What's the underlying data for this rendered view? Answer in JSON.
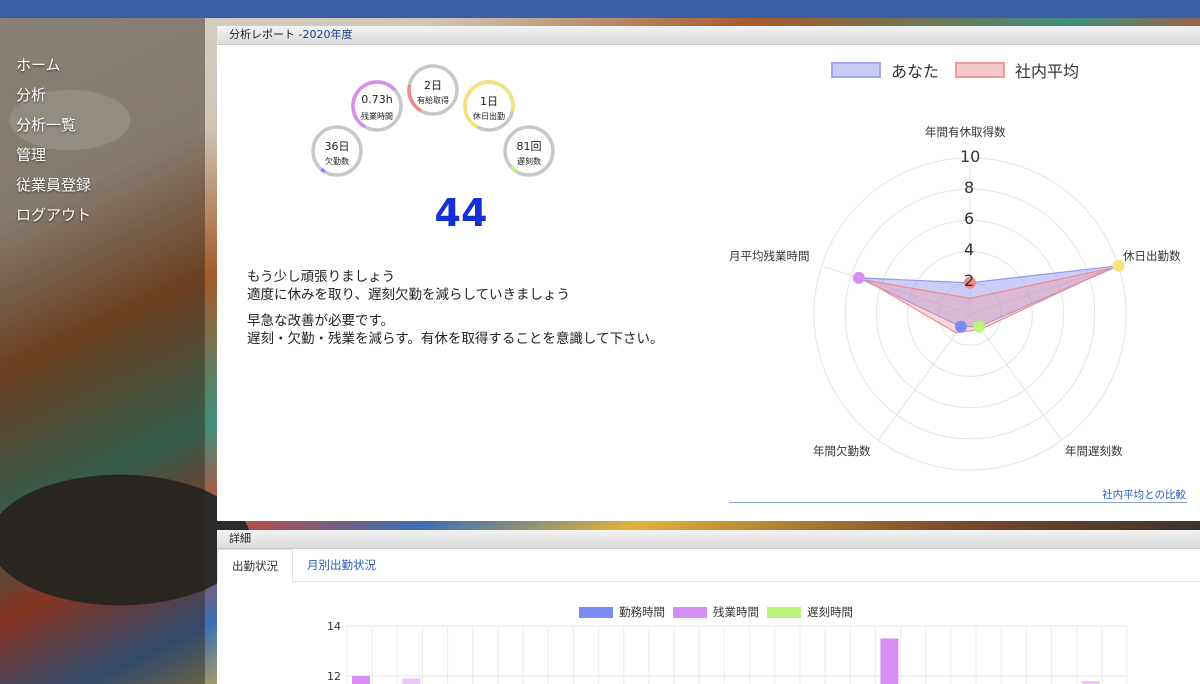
{
  "nav": {
    "items": [
      {
        "label": "ホーム"
      },
      {
        "label": "分析"
      },
      {
        "label": "分析一覧"
      },
      {
        "label": "管理"
      },
      {
        "label": "従業員登録"
      },
      {
        "label": "ログアウト"
      }
    ]
  },
  "report": {
    "title": "分析レポート",
    "year": "-2020年度",
    "gauges": [
      {
        "value": "36日",
        "label": "欠勤数",
        "color": "#7d8cf5",
        "fill": 0.03
      },
      {
        "value": "0.73h",
        "label": "残業時間",
        "color": "#d78ef2",
        "fill": 0.55
      },
      {
        "value": "2日",
        "label": "有給取得",
        "color": "#f08a8a",
        "fill": 0.2
      },
      {
        "value": "1日",
        "label": "休日出勤",
        "color": "#f5e27a",
        "fill": 0.7
      },
      {
        "value": "81回",
        "label": "遅刻数",
        "color": "#b8f57a",
        "fill": 0.05
      }
    ],
    "score": "44",
    "messages": [
      "もう少し頑張りましょう",
      "適度に休みを取り、遅刻欠勤を減らしていきましょう",
      "早急な改善が必要です。",
      "遅刻・欠勤・残業を減らす。有休を取得することを意識して下さい。"
    ],
    "compare_link": "社内平均との比較"
  },
  "radar": {
    "legend": [
      {
        "name": "あなた",
        "color": "#c9caf7",
        "border": "#a3a6f0"
      },
      {
        "name": "社内平均",
        "color": "#f8c7c7",
        "border": "#f29a9a"
      }
    ],
    "axes": [
      "年間有休取得数",
      "休日出勤数",
      "年間遅刻数",
      "年間欠勤数",
      "月平均残業時間"
    ],
    "ticks": [
      "10",
      "8",
      "6",
      "4",
      "2"
    ],
    "max": 10
  },
  "detail": {
    "title": "詳細",
    "tabs": [
      {
        "label": "出勤状況",
        "active": true
      },
      {
        "label": "月別出勤状況",
        "active": false
      }
    ],
    "legend": [
      {
        "name": "勤務時間",
        "color": "#7d8cf5"
      },
      {
        "name": "残業時間",
        "color": "#d78ef2"
      },
      {
        "name": "遅刻時間",
        "color": "#b8f57a"
      }
    ],
    "y_ticks": [
      "14",
      "12"
    ]
  },
  "chart_data": [
    {
      "type": "radar",
      "axes": [
        "年間有休取得数",
        "休日出勤数",
        "年間遅刻数",
        "年間欠勤数",
        "月平均残業時間"
      ],
      "rlim": [
        0,
        10
      ],
      "ticks": [
        2,
        4,
        6,
        8,
        10
      ],
      "legend": "top",
      "series": [
        {
          "name": "あなた",
          "values": [
            2,
            10,
            1,
            1,
            7.5
          ]
        },
        {
          "name": "社内平均",
          "values": [
            1,
            9.5,
            1.2,
            1.5,
            7
          ]
        }
      ]
    },
    {
      "type": "bar",
      "ylim": [
        10,
        14
      ],
      "y_ticks": [
        12,
        14
      ],
      "legend": "top",
      "series": [
        {
          "name": "勤務時間",
          "values": []
        },
        {
          "name": "残業時間",
          "values": [
            12,
            11.9,
            13.5,
            11.8
          ]
        },
        {
          "name": "遅刻時間",
          "values": []
        }
      ]
    }
  ]
}
